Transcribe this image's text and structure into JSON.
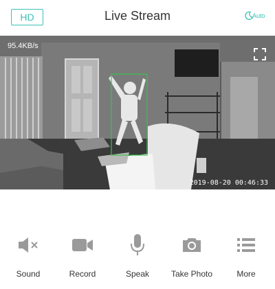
{
  "header": {
    "hd_label": "HD",
    "title": "Live Stream",
    "night_mode_label": "Auto"
  },
  "video": {
    "bitrate": "95.4KB/s",
    "timestamp": "2019-08-20 00:46:33"
  },
  "controls": [
    {
      "label": "Sound",
      "icon": "speaker-muted-icon"
    },
    {
      "label": "Record",
      "icon": "video-camera-icon"
    },
    {
      "label": "Speak",
      "icon": "microphone-icon"
    },
    {
      "label": "Take Photo",
      "icon": "camera-icon"
    },
    {
      "label": "More",
      "icon": "menu-list-icon"
    }
  ],
  "colors": {
    "accent": "#3cc0b4",
    "icon_gray": "#9a9a9a",
    "detection_box": "#37c24a"
  }
}
